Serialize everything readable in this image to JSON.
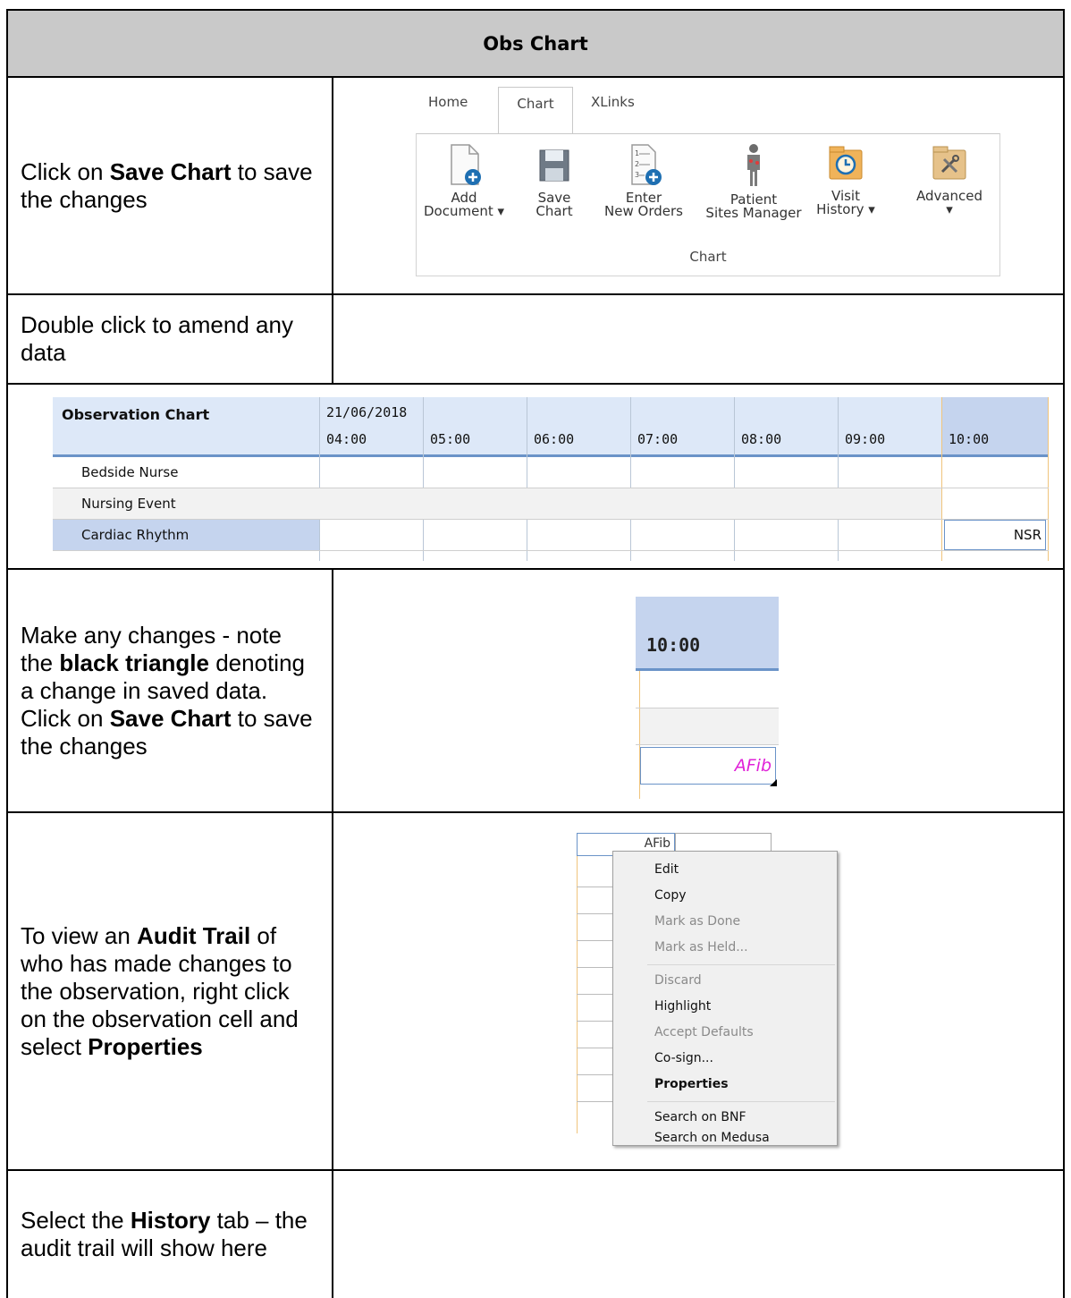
{
  "header": {
    "title": "Obs Chart"
  },
  "rows": [
    {
      "parts": [
        {
          "t": "Click on "
        },
        {
          "t": "Save Chart",
          "b": true
        },
        {
          "t": " to save the changes"
        }
      ]
    },
    {
      "parts": [
        {
          "t": "Double click to amend any data"
        }
      ]
    },
    {
      "parts": []
    },
    {
      "parts": [
        {
          "t": "Make any changes - note the "
        },
        {
          "t": "black triangle",
          "b": true
        },
        {
          "t": " denoting a change in saved data. Click on "
        },
        {
          "t": "Save Chart",
          "b": true
        },
        {
          "t": " to save the changes"
        }
      ]
    },
    {
      "parts": [
        {
          "t": "To view an "
        },
        {
          "t": "Audit Trail",
          "b": true
        },
        {
          "t": " of who has made changes to the observation, right click on the observation cell and select "
        },
        {
          "t": "Properties",
          "b": true
        }
      ]
    },
    {
      "parts": [
        {
          "t": "Select the "
        },
        {
          "t": "History",
          "b": true
        },
        {
          "t": " tab – the audit trail will show here"
        }
      ]
    }
  ],
  "ribbon": {
    "tabs": [
      "Home",
      "Chart",
      "XLinks"
    ],
    "buttons": [
      {
        "line1": "Add",
        "line2": "Document ▾",
        "icon": "add-document-icon"
      },
      {
        "line1": "Save",
        "line2": "Chart",
        "icon": "save-icon"
      },
      {
        "line1": "Enter",
        "line2": "New Orders",
        "icon": "new-orders-icon"
      },
      {
        "line1": "Patient",
        "line2": "Sites Manager",
        "icon": "patient-icon"
      },
      {
        "line1": "Visit",
        "line2": "History ▾",
        "icon": "history-icon"
      },
      {
        "line1": "Advanced",
        "line2": "▾",
        "icon": "tools-icon"
      }
    ],
    "group_label": "Chart"
  },
  "obs_chart": {
    "title": "Observation Chart",
    "date": "21/06/2018",
    "times": [
      "04:00",
      "05:00",
      "06:00",
      "07:00",
      "08:00",
      "09:00",
      "10:00"
    ],
    "rows": [
      "Bedside Nurse",
      "Nursing Event",
      "Cardiac Rhythm"
    ],
    "cell_value": "NSR"
  },
  "zoom_cell": {
    "time": "10:00",
    "value": "AFib"
  },
  "context_menu": {
    "cell_value": "AFib",
    "items": [
      {
        "label": "Edit",
        "state": "normal"
      },
      {
        "label": "Copy",
        "state": "normal"
      },
      {
        "label": "Mark as Done",
        "state": "disabled"
      },
      {
        "label": "Mark as Held...",
        "state": "disabled"
      },
      {
        "label": "Discard",
        "state": "disabled"
      },
      {
        "label": "Highlight",
        "state": "normal"
      },
      {
        "label": "Accept Defaults",
        "state": "disabled"
      },
      {
        "label": "Co-sign...",
        "state": "normal"
      },
      {
        "label": "Properties",
        "state": "bold"
      },
      {
        "label": "Search on BNF",
        "state": "normal"
      },
      {
        "label": "Search on Medusa",
        "state": "normal"
      }
    ]
  },
  "colors": {
    "header_bg": "#c9c9c9",
    "obs_header_bg": "#dde8f8",
    "selected_column": "#c5d4ee",
    "accent_blue": "#6a93c8",
    "changed_value": "#e021d8"
  }
}
